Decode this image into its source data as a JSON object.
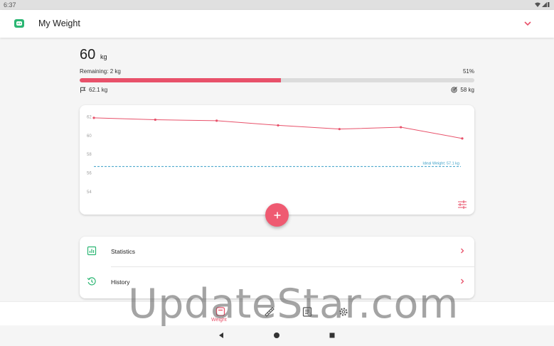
{
  "status_bar": {
    "time": "6:37"
  },
  "app_bar": {
    "title": "My Weight"
  },
  "summary": {
    "weight": "60",
    "unit": "kg",
    "remaining": "Remaining: 2 kg",
    "progress_percent": 51,
    "progress_label": "51%",
    "start_weight": "62.1 kg",
    "goal_weight": "58 kg"
  },
  "chart_data": {
    "type": "line",
    "x": [
      1,
      2,
      3,
      4,
      5,
      6,
      7
    ],
    "series": [
      {
        "values": [
          61.9,
          61.7,
          61.6,
          61.1,
          60.7,
          60.9,
          59.7
        ]
      }
    ],
    "ylim": [
      53,
      62.5
    ],
    "yticks": [
      "62",
      "60",
      "58",
      "56",
      "54"
    ],
    "ytick_values": [
      62,
      60,
      58,
      56,
      54
    ],
    "reference_line": {
      "label": "Ideal Weight: 57.1 kg",
      "value": 56.7
    },
    "line_color": "#e8516a",
    "reference_color": "#3a9fc7",
    "grid": false
  },
  "list": {
    "items": [
      {
        "label": "Statistics",
        "icon": "statistics-icon"
      },
      {
        "label": "History",
        "icon": "history-icon"
      }
    ]
  },
  "bottom_nav": {
    "active_label": "Weight",
    "items": [
      "weight-icon",
      "ruler-icon",
      "notes-icon",
      "settings-icon"
    ]
  },
  "watermark": "UpdateStar.com",
  "colors": {
    "accent": "#e8516a",
    "green": "#2bb673"
  }
}
